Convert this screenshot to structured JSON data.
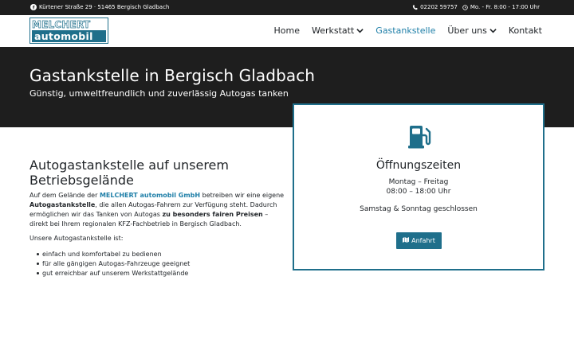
{
  "topbar": {
    "address": "Kürtener Straße 29 · 51465 Bergisch Gladbach",
    "phone": "02202 59757",
    "hours": "Mo. - Fr. 8:00 - 17:00 Uhr",
    "icons": [
      "facebook-icon",
      "phone-icon",
      "clock-icon"
    ]
  },
  "logo": {
    "line1": "MELCHERT",
    "line2": "automobil"
  },
  "nav": {
    "items": [
      {
        "label": "Home"
      },
      {
        "label": "Werkstatt"
      },
      {
        "label": "Gastankstelle"
      },
      {
        "label": "Über uns"
      },
      {
        "label": "Kontakt"
      }
    ],
    "active": "Gastankstelle"
  },
  "hero": {
    "title": "Gastankstelle in Bergisch Gladbach",
    "subtitle": "Günstig, umweltfreundlich und zuverlässig Autogas tanken"
  },
  "main": {
    "heading": "Autogastankstelle auf unserem Betriebsgelände",
    "p1": {
      "a": "Auf dem Gelände der ",
      "link": "MELCHERT automobil GmbH",
      "b": " betreiben wir eine eigene ",
      "bold1": "Autogastankstelle",
      "c": ", die allen Autogas-Fahrern zur Verfügung steht. Dadurch ermöglichen wir das Tanken von Autogas ",
      "bold2": "zu besonders fairen Preisen",
      "d": " – direkt bei Ihrem regionalen KFZ-Fachbetrieb in Bergisch Gladbach."
    },
    "p2": "Unsere Autogastankstelle ist:",
    "list": [
      "einfach und komfortabel zu bedienen",
      "für alle gängigen Autogas-Fahrzeuge geeignet",
      "gut erreichbar auf unserem Werkstattgelände"
    ]
  },
  "hours_card": {
    "icon": "gas-pump-icon",
    "title": "Öffnungszeiten",
    "weekdays": "Montag – Freitag",
    "weekday_hours": "08:00 – 18:00 Uhr",
    "weekend": "Samstag & Sonntag geschlossen",
    "button": "Anfahrt",
    "button_icon": "map-icon"
  },
  "colors": {
    "accent": "#1f6f8b",
    "link": "#1f7fa8",
    "dark": "#1e1e1e"
  }
}
